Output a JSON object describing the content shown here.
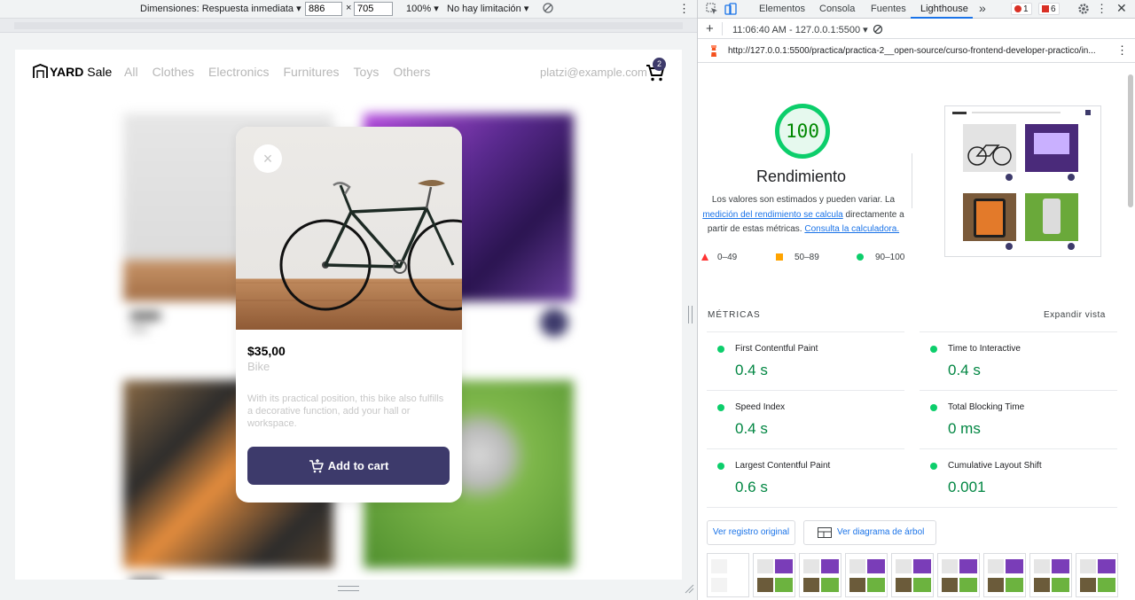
{
  "device_toolbar": {
    "dimensions_label": "Dimensiones: Respuesta inmediata ▾",
    "width_value": "886",
    "times": "×",
    "height_value": "705",
    "zoom": "100% ▾",
    "throttling": "No hay limitación ▾"
  },
  "webpage": {
    "logo_text_bold": "YARD",
    "logo_text": " Sale",
    "nav": [
      "All",
      "Clothes",
      "Electronics",
      "Furnitures",
      "Toys",
      "Others"
    ],
    "email": "platzi@example.com",
    "cart_count": "2",
    "modal": {
      "close": "×",
      "price": "$35,00",
      "name": "Bike",
      "description": "With its practical position, this bike also fulfills a decorative function, add your hall or workspace.",
      "add_button": "Add to cart"
    }
  },
  "devtools": {
    "tabs": [
      "Elementos",
      "Consola",
      "Fuentes",
      "Lighthouse"
    ],
    "active_tab": "Lighthouse",
    "more_tabs": "»",
    "error_count": "1",
    "issue_count": "6",
    "report_selector": "11:06:40 AM - 127.0.0.1:5500 ▾",
    "add": "+",
    "url": "http://127.0.0.1:5500/practica/practica-2__open-source/curso-frontend-developer-practico/in...",
    "kebab": "⋮"
  },
  "lighthouse": {
    "score": "100",
    "category": "Rendimiento",
    "note_prefix": "Los valores son estimados y pueden variar. La",
    "note_link1": "medición del rendimiento se calcula",
    "note_mid": "directamente a partir de estas métricas.",
    "note_link2": "Consulta la calculadora.",
    "legend": [
      "0–49",
      "50–89",
      "90–100"
    ],
    "metrics_heading": "MÉTRICAS",
    "expand_view": "Expandir vista",
    "metrics": [
      {
        "label": "First Contentful Paint",
        "value": "0.4 s"
      },
      {
        "label": "Time to Interactive",
        "value": "0.4 s"
      },
      {
        "label": "Speed Index",
        "value": "0.4 s"
      },
      {
        "label": "Total Blocking Time",
        "value": "0 ms"
      },
      {
        "label": "Largest Contentful Paint",
        "value": "0.6 s"
      },
      {
        "label": "Cumulative Layout Shift",
        "value": "0.001"
      }
    ],
    "view_original": "Ver registro original",
    "view_treemap": "Ver diagrama de árbol"
  },
  "colors": {
    "brand": "#3d3a6b",
    "pass_green": "#0cce6b",
    "pass_text": "#018642",
    "devtools_blue": "#1a73e8",
    "error_red": "#d93025"
  }
}
